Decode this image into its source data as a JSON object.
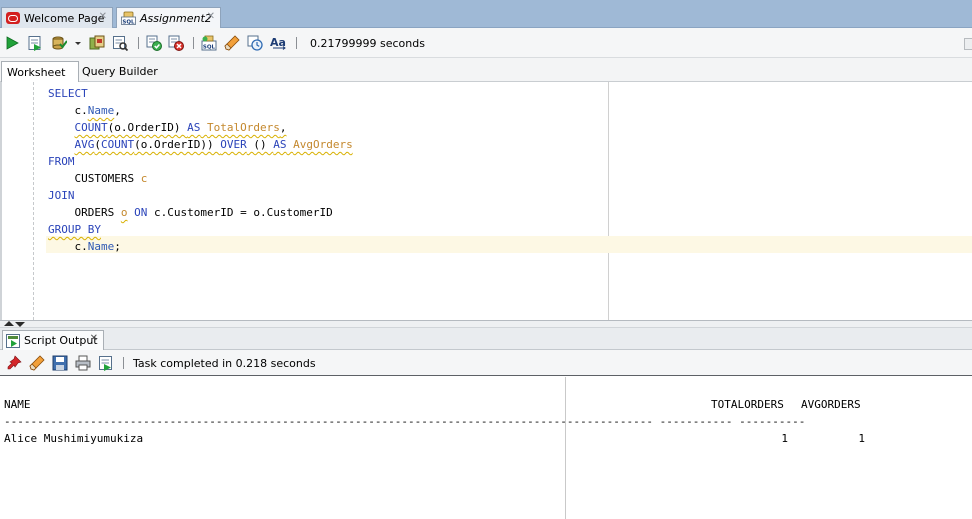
{
  "doc_tabs": [
    {
      "label": "Welcome Page",
      "close": "✕",
      "icon": "oracle-icon",
      "active": false
    },
    {
      "label": "Assignment2",
      "close": "✕",
      "icon": "sql-worksheet-icon",
      "active": true
    }
  ],
  "toolbar": {
    "elapsed": "0.21799999 seconds",
    "icons": [
      "run-statement-icon",
      "run-script-icon",
      "commit-icon",
      "dropdown-arrow-icon",
      "rollback-icon",
      "explain-plan-icon",
      "autotrace-icon",
      "sql-tuning-icon",
      "clear-icon",
      "sql-history-icon",
      "unshared-sql-icon",
      "to-upper-lower-icon"
    ]
  },
  "sub_tabs": {
    "worksheet": "Worksheet",
    "query_builder": "Query Builder"
  },
  "editor": {
    "lines": [
      [
        {
          "t": "SELECT",
          "c": "kw"
        }
      ],
      [
        {
          "t": "    "
        },
        {
          "t": "c.",
          "c": ""
        },
        {
          "t": "Name",
          "c": "col squig"
        },
        {
          "t": ","
        }
      ],
      [
        {
          "t": "    "
        },
        {
          "t": "COUNT(o.OrderID) AS TotalOrders,",
          "c": "squig",
          "parts": [
            {
              "t": "COUNT",
              "c": "kw"
            },
            {
              "t": "(o.OrderID) "
            },
            {
              "t": "AS",
              "c": "kw"
            },
            {
              "t": " "
            },
            {
              "t": "TotalOrders",
              "c": "warn"
            },
            {
              "t": ","
            }
          ]
        }
      ],
      [
        {
          "t": "    "
        },
        {
          "t": "AVG(COUNT(o.OrderID)) OVER () AS AvgOrders",
          "c": "squig",
          "parts": [
            {
              "t": "AVG",
              "c": "kw"
            },
            {
              "t": "("
            },
            {
              "t": "COUNT",
              "c": "kw"
            },
            {
              "t": "(o.OrderID)) "
            },
            {
              "t": "OVER",
              "c": "kw"
            },
            {
              "t": " () "
            },
            {
              "t": "AS",
              "c": "kw"
            },
            {
              "t": " "
            },
            {
              "t": "AvgOrders",
              "c": "warn"
            }
          ]
        }
      ],
      [
        {
          "t": "FROM",
          "c": "kw"
        }
      ],
      [
        {
          "t": "    CUSTOMERS "
        },
        {
          "t": "c",
          "c": "warn"
        }
      ],
      [
        {
          "t": "JOIN",
          "c": "kw"
        }
      ],
      [
        {
          "t": "    ORDERS "
        },
        {
          "t": "o",
          "c": "warn squig"
        },
        {
          "t": " "
        },
        {
          "t": "ON",
          "c": "kw"
        },
        {
          "t": " c.CustomerID = o.CustomerID"
        }
      ],
      [
        {
          "t": "GROUP BY",
          "c": "kw squig"
        }
      ],
      [
        {
          "t": "    c."
        },
        {
          "t": "Name",
          "c": "col"
        },
        {
          "t": ";"
        }
      ]
    ]
  },
  "output": {
    "tab_label": "Script Output",
    "tab_close": "✕",
    "message": "Task completed in 0.218 seconds",
    "icons": [
      "pin-icon",
      "eraser-icon",
      "save-icon",
      "print-icon",
      "open-file-icon"
    ],
    "columns": [
      "NAME",
      "TOTALORDERS",
      "AVGORDERS"
    ],
    "separator": "-------------------------------------------------------------------------------------------------- ----------- ----------",
    "rows": [
      [
        "Alice Mushimiyumukiza",
        "1",
        "1"
      ]
    ]
  }
}
